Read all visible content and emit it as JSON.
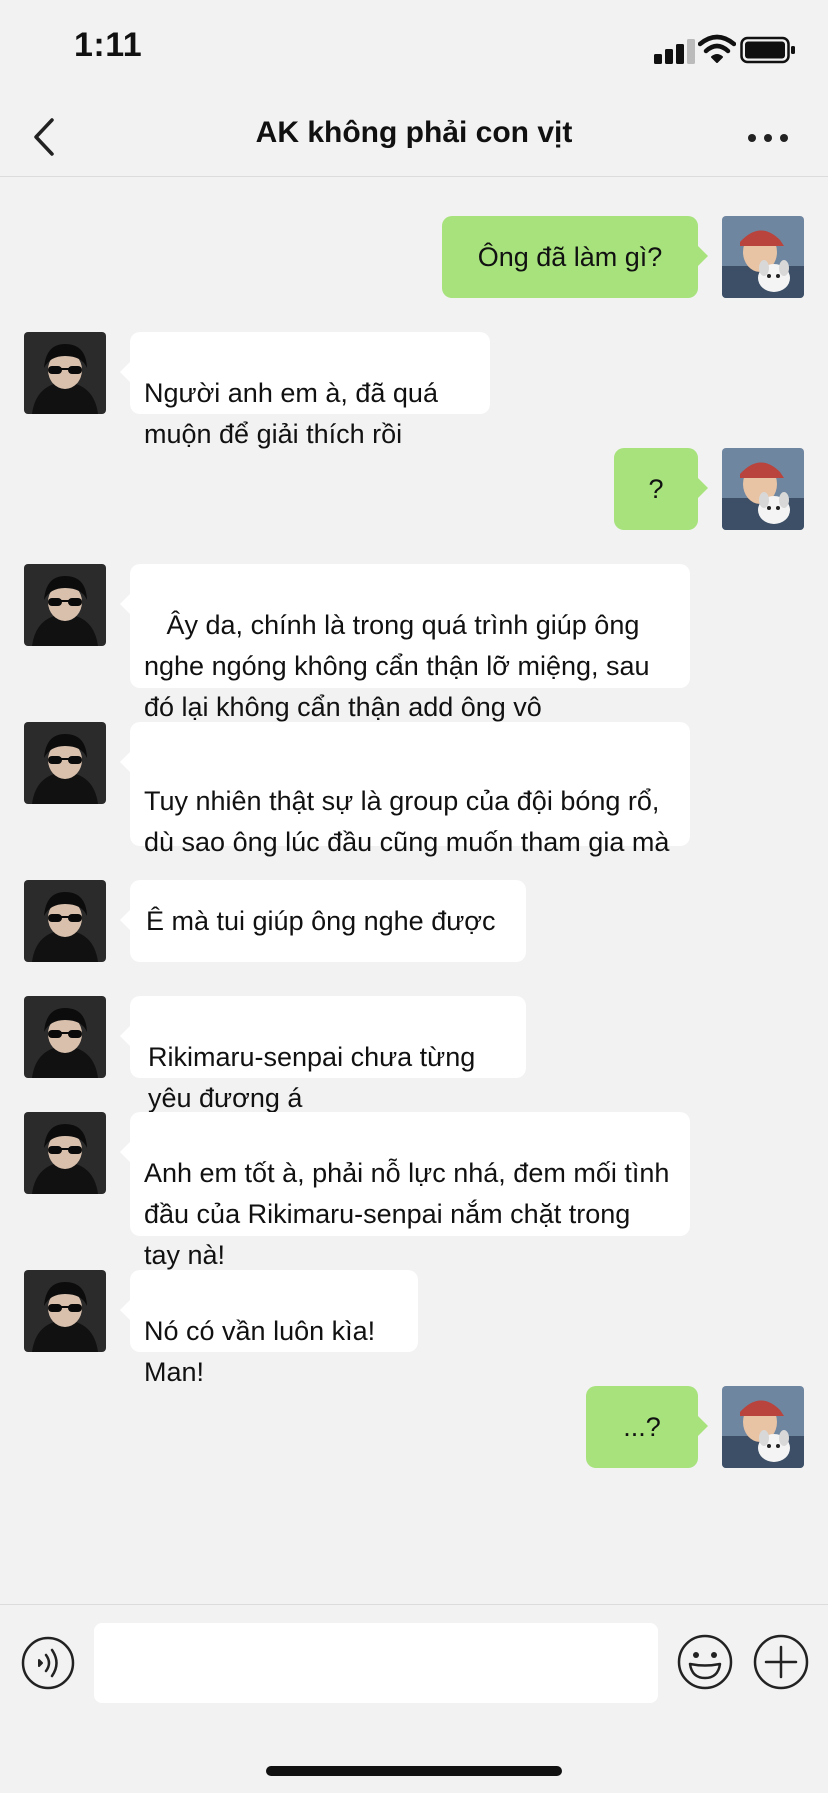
{
  "status_bar": {
    "time": "1:11"
  },
  "header": {
    "title": "AK không phải con vịt"
  },
  "messages": [
    {
      "sender": "me",
      "text": "Ông đã làm gì?"
    },
    {
      "sender": "them",
      "text": "Người anh em à, đã quá\nmuộn để giải thích rồi"
    },
    {
      "sender": "me",
      "text": "?"
    },
    {
      "sender": "them",
      "text": " Ây da, chính là trong quá trình giúp ông\nnghe ngóng không cẩn thận lỡ miệng, sau\nđó lại không cẩn thận add ông vô"
    },
    {
      "sender": "them",
      "text": "Tuy nhiên thật sự là group của đội bóng rổ,\ndù sao ông lúc đầu cũng muốn tham gia mà"
    },
    {
      "sender": "them",
      "text": "Ê mà tui giúp ông nghe được"
    },
    {
      "sender": "them",
      "text": "Rikimaru-senpai chưa từng\nyêu đương á"
    },
    {
      "sender": "them",
      "text": "Anh em tốt à, phải nỗ lực nhá, đem mối tình\nđầu của Rikimaru-senpai nắm chặt trong\ntay nà!"
    },
    {
      "sender": "them",
      "text": "Nó có vần luôn kìa!\nMan!"
    },
    {
      "sender": "me",
      "text": "...?"
    }
  ],
  "input": {
    "value": "",
    "placeholder": ""
  },
  "icons": {
    "back": "chevron-left-icon",
    "more": "more-horizontal-icon",
    "voice": "voice-icon",
    "emoji": "emoji-icon",
    "plus": "plus-icon"
  },
  "colors": {
    "background": "#f2f2f2",
    "outgoing_bubble": "#a7e27c",
    "incoming_bubble": "#ffffff"
  }
}
